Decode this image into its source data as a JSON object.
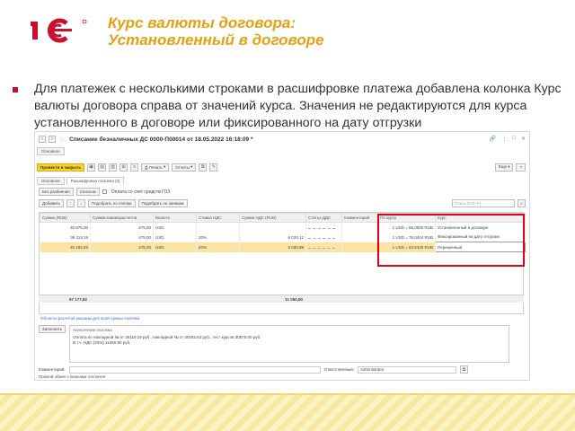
{
  "slide": {
    "title_line1": "Курс валюты договора:",
    "title_line2": "Установленный в договоре",
    "body": "Для платежек с несколькими строками в расшифровке платежа добавлена колонка Курс валюты договора справа от значений курса. Значения не редактируются для курса установленного в договоре или фиксированного на дату отгрузки"
  },
  "colors": {
    "title": "#e8a012",
    "bullet": "#c8102e",
    "primary_button": "#f7d22a",
    "highlight_box": "#e0001b",
    "selected_row": "#fbe3a2"
  },
  "window": {
    "doc_title": "Списание безналичных ДС 0000-П00014 от 18.05.2022 16:18:09 *",
    "tabs": [
      "Основное",
      "Расшифровка платежа (3)"
    ],
    "toolbar": {
      "post_close": "Провести и закрыть",
      "print": "Печать",
      "reports": "Отчеты"
    },
    "subtoolbar": {
      "no_split": "Без разбиения",
      "list": "Списком",
      "goz": "Оплата со счет средств ГОЗ"
    },
    "table_toolbar": {
      "add": "Добавить",
      "fill_by_invoices": "Подобрать по счетам",
      "fill_by_bills": "Подобрать по заявкам",
      "search_placeholder": "Поиск (Ctrl+F)"
    },
    "columns": [
      "Сумма (RUB)",
      "Сумма взаиморасчетов",
      "Валюта",
      "Ставка НДС",
      "Сумма НДС (RUB)",
      "Статья ДДС",
      "Комментарий",
      "По курсу",
      "Курс"
    ],
    "rows": [
      {
        "sum": "30 875,00",
        "mutual": "475,00",
        "currency": "USD",
        "vat_rate": "",
        "vat": "",
        "rate": "1 USD = 65,0000 RUB",
        "rate_type": "Установленный в договоре"
      },
      {
        "sum": "36 119,19",
        "mutual": "475,00",
        "currency": "USD",
        "vat_rate": "20%",
        "vat": "6 020,12",
        "rate": "1 USD = 76,0404 RUB",
        "rate_type": "Фиксированный на дату отгрузки"
      },
      {
        "sum": "30 182,63",
        "mutual": "475,00",
        "currency": "USD",
        "vat_rate": "20%",
        "vat": "5 030,68",
        "rate": "1 USD = 63,5428 RUB",
        "rate_type": "Переменный"
      }
    ],
    "totals": {
      "sum": "97 177,82",
      "vat": "11 050,80"
    },
    "link_under_table": "Объекты расчетов указаны для всей суммы платежа",
    "purpose": {
      "button": "Заполнить",
      "label": "Назначение платежа",
      "line1": "Оплата по накладной № от  36119.19 руб.,  накладной № от  30182.63 руб., тест курсов 30875.00 руб.",
      "line2": "В т.ч. НДС (20%) 11050.80 руб."
    },
    "comment_label": "Комментарий:",
    "responsible_label": "Ответственный:",
    "responsible_value": "Administrator",
    "footer_note": "Прямой обмен с Банками отключен"
  }
}
